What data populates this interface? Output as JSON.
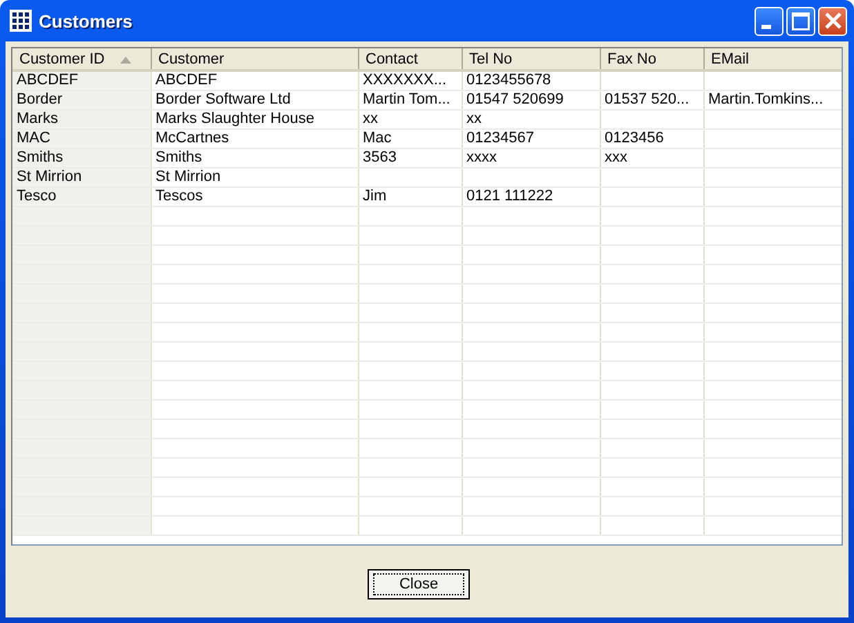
{
  "window": {
    "title": "Customers"
  },
  "table": {
    "columns": [
      {
        "label": "Customer ID",
        "sorted": true
      },
      {
        "label": "Customer",
        "sorted": false
      },
      {
        "label": "Contact",
        "sorted": false
      },
      {
        "label": "Tel No",
        "sorted": false
      },
      {
        "label": "Fax No",
        "sorted": false
      },
      {
        "label": "EMail",
        "sorted": false
      }
    ],
    "rows": [
      [
        "ABCDEF",
        "ABCDEF",
        "XXXXXXX...",
        "0123455678",
        "",
        ""
      ],
      [
        "Border",
        "Border Software Ltd",
        "Martin Tom...",
        "01547 520699",
        "01537 520...",
        "Martin.Tomkins..."
      ],
      [
        "Marks",
        "Marks Slaughter House",
        "xx",
        "xx",
        "",
        ""
      ],
      [
        "MAC",
        "McCartnes",
        "Mac",
        "01234567",
        "0123456",
        ""
      ],
      [
        "Smiths",
        "Smiths",
        "3563",
        "xxxx",
        "xxx",
        ""
      ],
      [
        "St Mirrion",
        "St Mirrion",
        "",
        "",
        "",
        ""
      ],
      [
        "Tesco",
        "Tescos",
        "Jim",
        "0121 111222",
        "",
        ""
      ]
    ]
  },
  "buttons": [
    {
      "label": "Close",
      "focused": true
    }
  ]
}
